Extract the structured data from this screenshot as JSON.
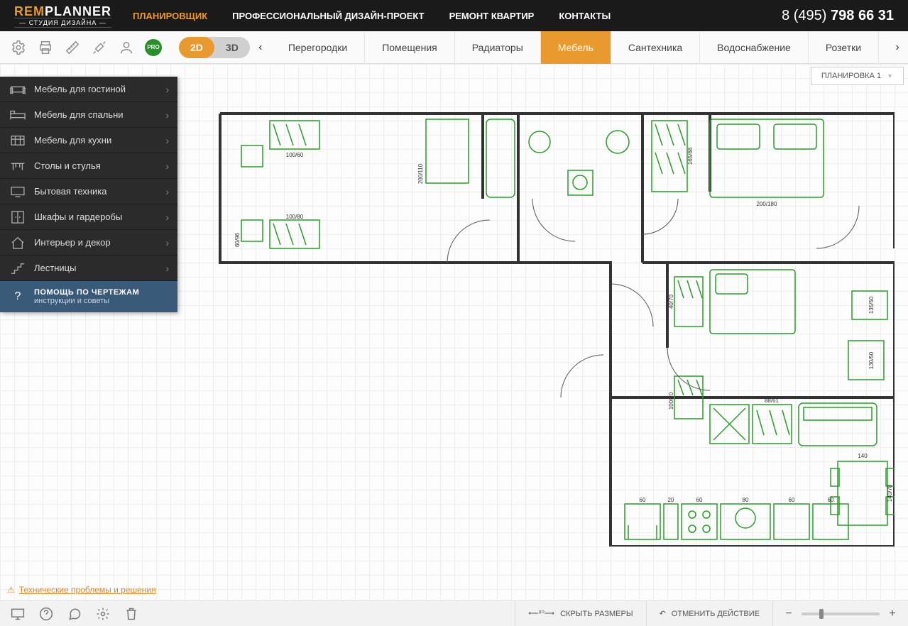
{
  "header": {
    "logo_rem": "REM",
    "logo_planner": "PLANNER",
    "logo_sub": "— СТУДИЯ ДИЗАЙНА —",
    "nav": [
      "ПЛАНИРОВЩИК",
      "ПРОФЕССИОНАЛЬНЫЙ ДИЗАЙН-ПРОЕКТ",
      "РЕМОНТ КВАРТИР",
      "КОНТАКТЫ"
    ],
    "phone_light": "8 (495) ",
    "phone_bold": "798 66 31"
  },
  "toolbar": {
    "pro": "PRO",
    "view": {
      "two_d": "2D",
      "three_d": "3D"
    },
    "tabs": [
      "Перегородки",
      "Помещения",
      "Радиаторы",
      "Мебель",
      "Сантехника",
      "Водоснабжение",
      "Розетки"
    ],
    "active_tab_index": 3
  },
  "layout_selector": "ПЛАНИРОВКА 1",
  "sidebar": {
    "items": [
      {
        "label": "Мебель для гостиной",
        "icon": "sofa-icon"
      },
      {
        "label": "Мебель для спальни",
        "icon": "bed-icon"
      },
      {
        "label": "Мебель для кухни",
        "icon": "kitchen-icon"
      },
      {
        "label": "Столы и стулья",
        "icon": "table-icon"
      },
      {
        "label": "Бытовая техника",
        "icon": "tv-icon"
      },
      {
        "label": "Шкафы и гардеробы",
        "icon": "wardrobe-icon"
      },
      {
        "label": "Интерьер и декор",
        "icon": "home-icon"
      },
      {
        "label": "Лестницы",
        "icon": "stairs-icon"
      }
    ],
    "help": {
      "title": "ПОМОЩЬ ПО ЧЕРТЕЖАМ",
      "subtitle": "инструкции и советы",
      "icon": "?"
    }
  },
  "floorplan_labels": {
    "dims": [
      "100/60",
      "200/110",
      "100/80",
      "60/96",
      "165/68",
      "200/180",
      "40/70",
      "100/70",
      "135/50",
      "130/50",
      "88/61",
      "140",
      "140/78",
      "60",
      "20",
      "60",
      "80",
      "60",
      "60"
    ]
  },
  "footer": {
    "tech_link": "Технические проблемы и решения",
    "hide_sizes": "СКРЫТЬ РАЗМЕРЫ",
    "undo": "ОТМЕНИТЬ ДЕЙСТВИЕ"
  }
}
